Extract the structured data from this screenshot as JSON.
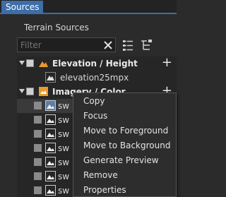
{
  "tabs": [
    {
      "label": "Sources"
    }
  ],
  "panel": {
    "title": "Terrain Sources"
  },
  "filter": {
    "placeholder": "Filter"
  },
  "tree": {
    "groups": [
      {
        "label": "Elevation / Height",
        "add": "+",
        "children": [
          {
            "label": "elevation25mpx"
          }
        ]
      },
      {
        "label": "Imagery / Color",
        "add": "+",
        "children": [
          {
            "label": "sw"
          },
          {
            "label": "sw"
          },
          {
            "label": "sw"
          },
          {
            "label": "sw"
          },
          {
            "label": "sw"
          },
          {
            "label": "sw"
          },
          {
            "label": "sw"
          },
          {
            "label": "sw"
          }
        ]
      }
    ]
  },
  "context_menu": {
    "items": [
      {
        "label": "Copy"
      },
      {
        "label": "Focus"
      },
      {
        "label": "Move to Foreground"
      },
      {
        "label": "Move to Background"
      },
      {
        "label": "Generate Preview"
      },
      {
        "label": "Remove"
      },
      {
        "label": "Properties"
      }
    ]
  },
  "colors": {
    "accent": "#3d6ea8",
    "folder": "#e89a2c",
    "background": "#2b2b2b"
  }
}
